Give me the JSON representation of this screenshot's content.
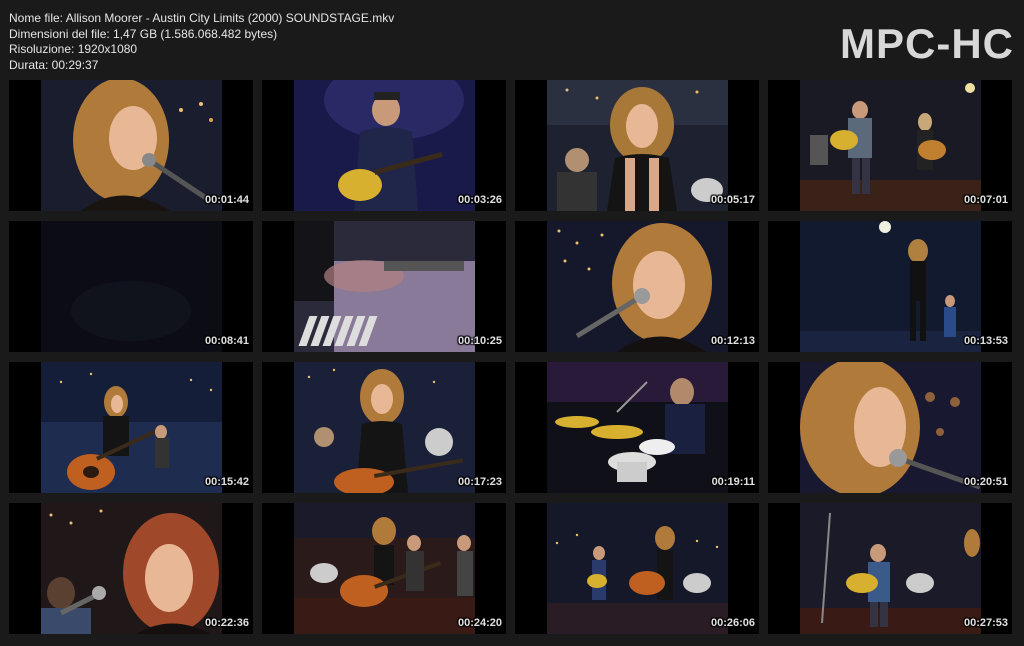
{
  "file_info": {
    "name": "Nome file: Allison Moorer - Austin City Limits (2000) SOUNDSTAGE.mkv",
    "size": "Dimensioni del file: 1,47 GB (1.586.068.482 bytes)",
    "resolution": "Risoluzione: 1920x1080",
    "duration": "Durata: 00:29:37"
  },
  "logo": "MPC-HC",
  "thumbnails": [
    {
      "timestamp": "00:01:44",
      "scene": "singer-closeup-mic"
    },
    {
      "timestamp": "00:03:26",
      "scene": "guitarist-blue-light"
    },
    {
      "timestamp": "00:05:17",
      "scene": "singer-medium-band"
    },
    {
      "timestamp": "00:07:01",
      "scene": "wide-stage-guitarists"
    },
    {
      "timestamp": "00:08:41",
      "scene": "dark-frame"
    },
    {
      "timestamp": "00:10:25",
      "scene": "keyboard-hands"
    },
    {
      "timestamp": "00:12:13",
      "scene": "singer-closeup-city"
    },
    {
      "timestamp": "00:13:53",
      "scene": "wide-stage-blue"
    },
    {
      "timestamp": "00:15:42",
      "scene": "singer-guitar-wide"
    },
    {
      "timestamp": "00:17:23",
      "scene": "singer-guitar-medium"
    },
    {
      "timestamp": "00:19:11",
      "scene": "drummer"
    },
    {
      "timestamp": "00:20:51",
      "scene": "singer-profile-closeup"
    },
    {
      "timestamp": "00:22:36",
      "scene": "singer-looking-down"
    },
    {
      "timestamp": "00:24:20",
      "scene": "band-full-stage"
    },
    {
      "timestamp": "00:26:06",
      "scene": "band-skyline"
    },
    {
      "timestamp": "00:27:53",
      "scene": "guitarist-wide-stage"
    }
  ],
  "colors": {
    "background": "#1a1a1a",
    "thumb_bg": "#000000",
    "text": "#e6e6e6"
  }
}
